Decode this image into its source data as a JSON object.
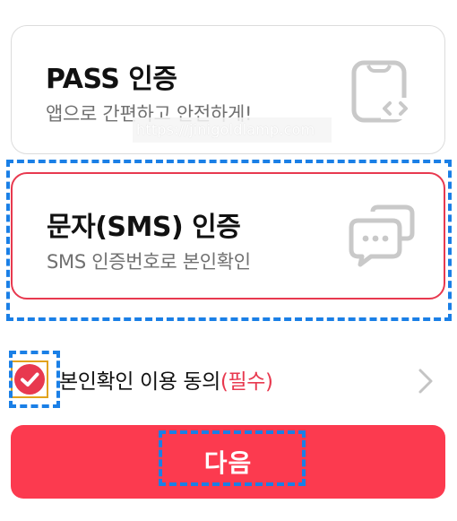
{
  "pass_card": {
    "title": "PASS 인증",
    "subtitle": "앱으로 간편하고 안전하게!",
    "icon": "phone-code-icon"
  },
  "watermark": "https://jinigoldlamp.com",
  "sms_card": {
    "title": "문자(SMS) 인증",
    "subtitle": "SMS 인증번호로 본인확인",
    "icon": "chat-bubbles-icon"
  },
  "agreement": {
    "label": "본인확인 이용 동의",
    "required": "(필수)",
    "checked": true
  },
  "next_button": {
    "label": "다음"
  },
  "colors": {
    "accent": "#fc3a4f",
    "selected_border": "#e8394f",
    "highlight": "#1a7fe6",
    "checkbox_outline": "#e2a21c"
  }
}
